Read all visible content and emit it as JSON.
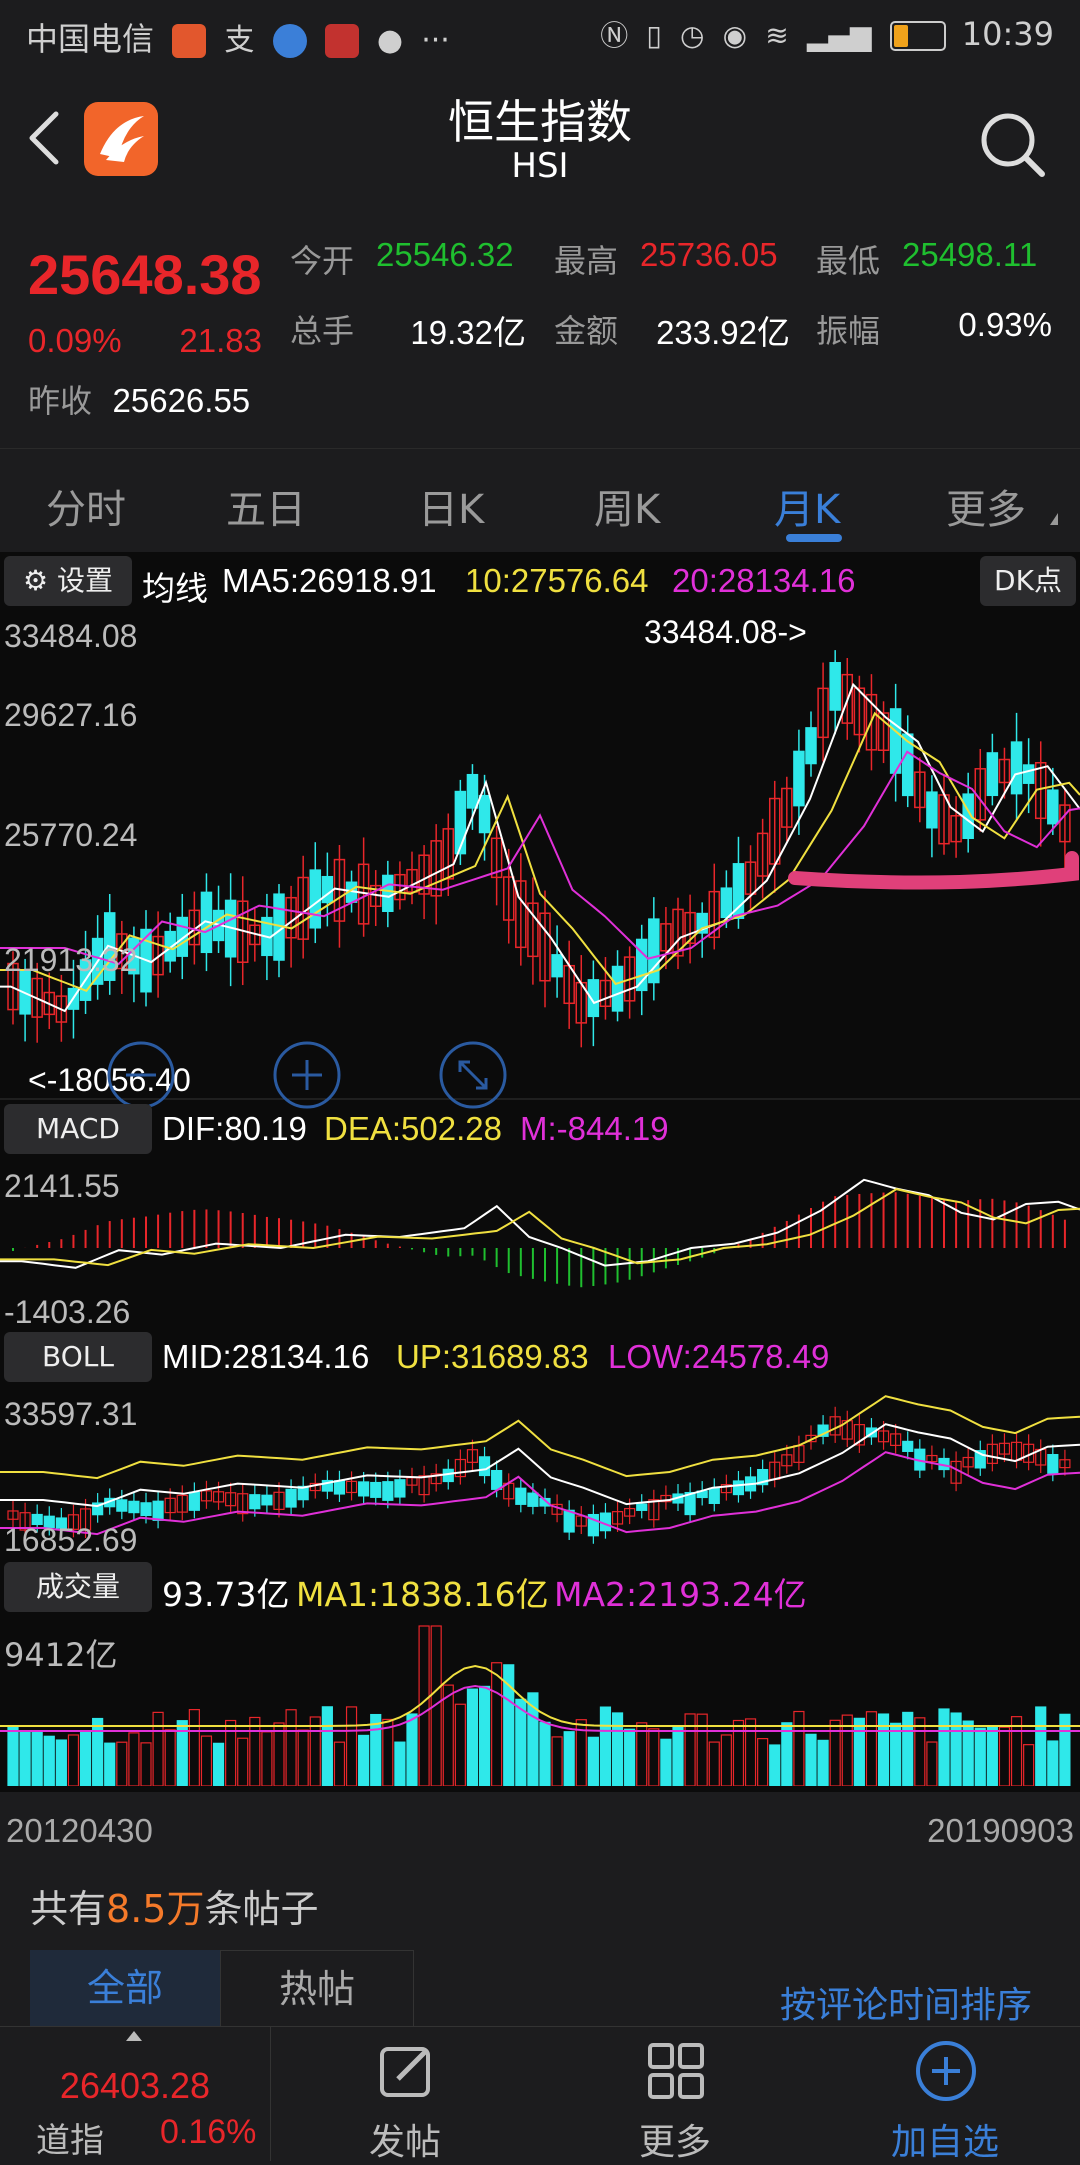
{
  "status_bar": {
    "carrier": "中国电信",
    "time": "10:39"
  },
  "header": {
    "title": "恒生指数",
    "subtitle": "HSI"
  },
  "quote": {
    "price": "25648.38",
    "change_pct": "0.09%",
    "change": "21.83",
    "prev_close_label": "昨收",
    "prev_close": "25626.55",
    "open_label": "今开",
    "open": "25546.32",
    "high_label": "最高",
    "high": "25736.05",
    "low_label": "最低",
    "low": "25498.11",
    "volume_label": "总手",
    "volume": "19.32亿",
    "amount_label": "金额",
    "amount": "233.92亿",
    "amplitude_label": "振幅",
    "amplitude": "0.93%"
  },
  "tabs": [
    "分时",
    "五日",
    "日K",
    "周K",
    "月K",
    "更多"
  ],
  "active_tab": "月K",
  "kline": {
    "settings_label": "设置",
    "ma_title": "均线",
    "ma5": "MA5:26918.91",
    "ma10": "10:27576.64",
    "ma20": "20:28134.16",
    "dk_label": "DK点",
    "y_labels": [
      "33484.08",
      "29627.16",
      "25770.24",
      "21913.32",
      "18056.40"
    ],
    "max_marker": "33484.08->",
    "min_marker": "<-18056.40"
  },
  "macd": {
    "label": "MACD",
    "dif": "DIF:80.19",
    "dea": "DEA:502.28",
    "m": "M:-844.19",
    "y_labels": [
      "2141.55",
      "-1403.26"
    ]
  },
  "boll": {
    "label": "BOLL",
    "mid": "MID:28134.16",
    "up": "UP:31689.83",
    "low": "LOW:24578.49",
    "y_labels": [
      "33597.31",
      "16852.69"
    ]
  },
  "volume": {
    "label": "成交量",
    "value": "93.73亿",
    "ma1": "MA1:1838.16亿",
    "ma2": "MA2:2193.24亿",
    "y_label": "9412亿"
  },
  "date_range": {
    "start": "20120430",
    "end": "20190903"
  },
  "posts": {
    "prefix": "共有",
    "count": "8.5万",
    "suffix": "条帖子",
    "tab_all": "全部",
    "tab_hot": "热帖",
    "sort": "按评论时间排序"
  },
  "bottom_bar": {
    "index_value": "26403.28",
    "index_name": "道指",
    "index_pct": "0.16%",
    "post": "发帖",
    "more": "更多",
    "add": "加自选"
  },
  "colors": {
    "up": "#e8262a",
    "down": "#1fbf2f",
    "accent": "#3a7fd8",
    "ma5": "#ffffff",
    "ma10": "#f0e040",
    "ma20": "#e030d8",
    "candle_down": "#2fe8ea"
  },
  "chart_data": {
    "type": "candlestick",
    "period": "monthly",
    "x_range": [
      "20120430",
      "20190903"
    ],
    "ylim": [
      18056.4,
      33484.08
    ],
    "annotations": [
      "33484.08->",
      "<-18056.40"
    ],
    "legend": [
      "MA5",
      "MA10",
      "MA20"
    ]
  }
}
